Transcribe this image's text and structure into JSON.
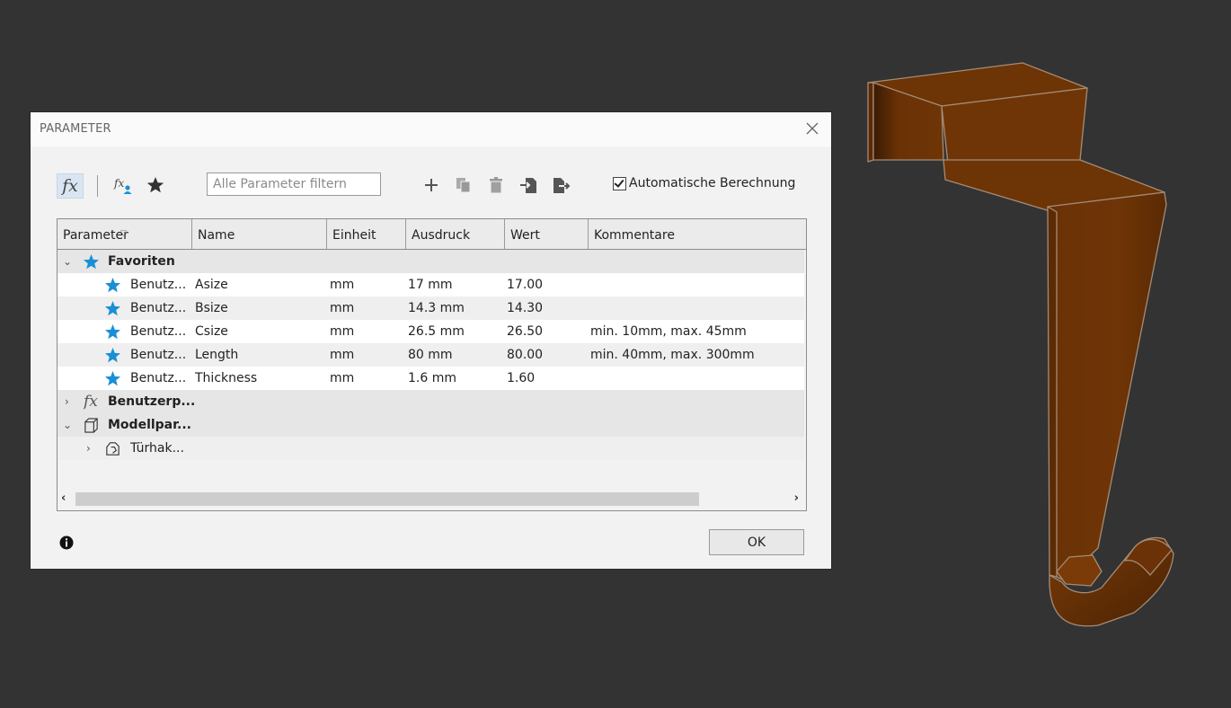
{
  "dialog": {
    "title": "PARAMETER",
    "filter_placeholder": "Alle Parameter filtern",
    "auto_calc_label": "Automatische Berechnung",
    "auto_calc_checked": true,
    "ok_label": "OK"
  },
  "toolbar": {
    "icons": [
      "fx-icon",
      "user-fx-icon",
      "star-icon",
      "add-icon",
      "copy-icon",
      "delete-icon",
      "import-icon",
      "export-icon"
    ]
  },
  "table": {
    "columns": [
      "Parameter",
      "Name",
      "Einheit",
      "Ausdruck",
      "Wert",
      "Kommentare"
    ],
    "favorites_label": "Favoriten",
    "favorites": [
      {
        "parameter": "Benutz...",
        "name": "Asize",
        "unit": "mm",
        "expression": "17 mm",
        "value": "17.00",
        "comment": ""
      },
      {
        "parameter": "Benutz...",
        "name": "Bsize",
        "unit": "mm",
        "expression": "14.3 mm",
        "value": "14.30",
        "comment": ""
      },
      {
        "parameter": "Benutz...",
        "name": "Csize",
        "unit": "mm",
        "expression": "26.5 mm",
        "value": "26.50",
        "comment": "min. 10mm, max. 45mm"
      },
      {
        "parameter": "Benutz...",
        "name": "Length",
        "unit": "mm",
        "expression": "80 mm",
        "value": "80.00",
        "comment": "min. 40mm, max. 300mm"
      },
      {
        "parameter": "Benutz...",
        "name": "Thickness",
        "unit": "mm",
        "expression": "1.6 mm",
        "value": "1.60",
        "comment": ""
      }
    ],
    "user_params_label": "Benutzerp...",
    "model_params_label": "Modellpar...",
    "model_child_label": "Türhak..."
  },
  "colors": {
    "accent_star": "#1a8fd6",
    "model_fill": "#6b3306",
    "background": "#333333"
  }
}
